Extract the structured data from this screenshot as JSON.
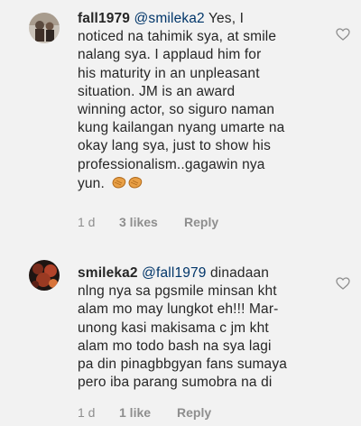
{
  "comments": [
    {
      "username": "fall1979",
      "mention": "@smileka2",
      "lines": [
        " Yes, I",
        "noticed na tahimik sya, at smile",
        "nalang sya.  I applaud him for",
        "his maturity in an unpleasant",
        "situation. JM is an award",
        "winning actor, so siguro naman",
        "kung kailangan nyang umarte na",
        "okay lang sya, just to show his",
        "professionalism..gagawin nya",
        "yun."
      ],
      "emoji": "shrimp-emoji",
      "time": "1 d",
      "likes": "3 likes",
      "reply": "Reply"
    },
    {
      "username": "smileka2",
      "mention": "@fall1979",
      "lines": [
        " dinadaan",
        "nlng nya sa pgsmile minsan kht",
        "alam mo may lungkot eh!!! Mar-",
        "unong kasi makisama c jm kht",
        "alam mo todo bash na sya lagi",
        "pa din pinagbbgyan fans sumaya",
        "pero iba parang sumobra na di"
      ],
      "time": "1 d",
      "likes": "1 like",
      "reply": "Reply"
    }
  ],
  "colors": {
    "text": "#262626",
    "mention": "#003569",
    "meta": "#8e8e8e",
    "background": "#f2f2f2"
  }
}
